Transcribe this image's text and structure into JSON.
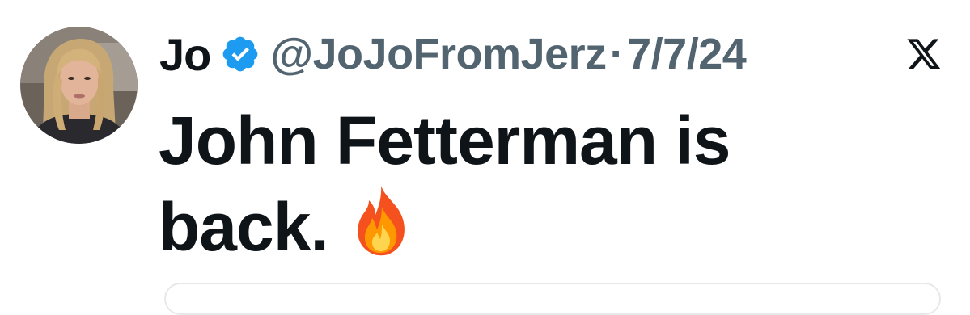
{
  "author": {
    "name": "Jo",
    "handle": "@JoJoFromJerz",
    "separator": "·",
    "date": "7/7/24",
    "verified_icon": "verified-badge-icon",
    "avatar": "profile-photo"
  },
  "platform_icon": "x-logo-icon",
  "tweet": {
    "text": "John Fetterman is back.",
    "emoji_icon": "fire-emoji-icon"
  },
  "colors": {
    "text_primary": "#0f1419",
    "text_secondary": "#536471",
    "verified_blue": "#1d9bf0"
  }
}
